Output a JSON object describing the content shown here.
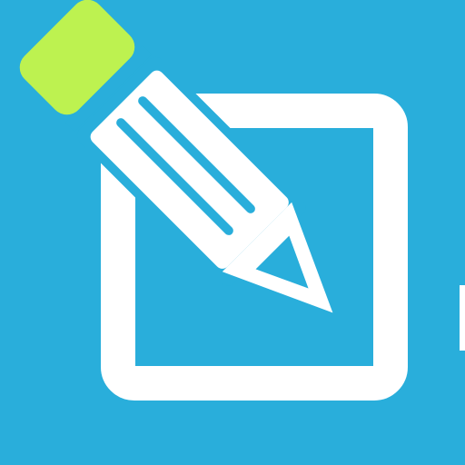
{
  "icon": {
    "name": "edit-note-icon",
    "semantic": "pencil-over-square",
    "colors": {
      "background": "#29aedb",
      "foreground": "#ffffff",
      "eraser": "#bdf250"
    }
  }
}
